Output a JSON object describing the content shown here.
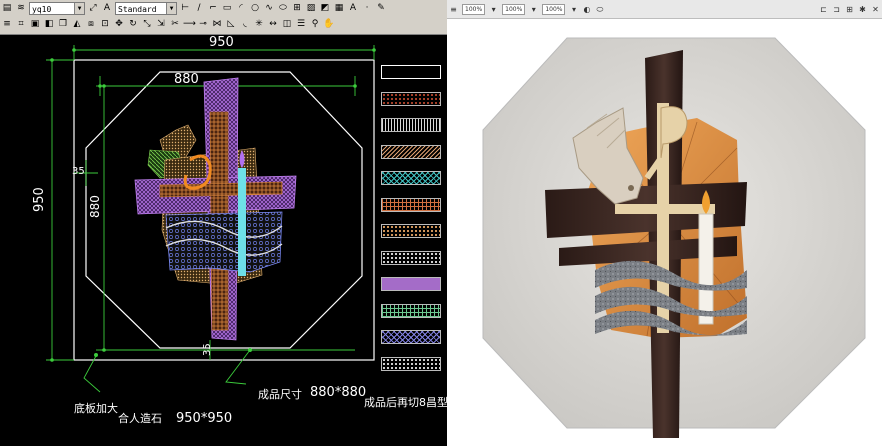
{
  "cad": {
    "toolbar": {
      "layer_value": "yq10",
      "style_value": "Standard"
    },
    "dimensions": {
      "outer_width": "950",
      "inner_width": "880",
      "outer_height": "950",
      "inner_height": "880",
      "corner_offset": "35",
      "bottom_offset": "35"
    },
    "notes": {
      "base_label": "底板加大",
      "base_material": "合人造石",
      "base_size": "950*950",
      "finished_label": "成品尺寸",
      "finished_size": "880*880",
      "cut_note": "成品后再切8昌型"
    },
    "legend_swatches": [
      {
        "pattern": "blank",
        "color": "#ffffff"
      },
      {
        "pattern": "dots",
        "color": "#b0442c"
      },
      {
        "pattern": "vertical-hatch",
        "color": "#d9d9d9"
      },
      {
        "pattern": "lines",
        "color": "#e0a070"
      },
      {
        "pattern": "zigzag",
        "color": "#40c0c0"
      },
      {
        "pattern": "grid",
        "color": "#d07040"
      },
      {
        "pattern": "hex",
        "color": "#e0a060"
      },
      {
        "pattern": "circles",
        "color": "#e0e0e0"
      },
      {
        "pattern": "solid",
        "color": "#a46cc8"
      },
      {
        "pattern": "brick",
        "color": "#6cc890"
      },
      {
        "pattern": "crosshatch",
        "color": "#8080e0"
      },
      {
        "pattern": "speckle",
        "color": "#e0e0e0"
      }
    ]
  },
  "render": {
    "toolbar": {
      "zoom_1": "100%",
      "zoom_2": "100%",
      "zoom_3": "100%"
    },
    "colors": {
      "background": "#dcdad6",
      "cross_dark": "#3a2620",
      "cross_light": "#e6d2a8",
      "sunburst": "#d8883e",
      "water": "#7b7f84",
      "candle": "#f4f1ea",
      "dove": "#d9cfc0"
    }
  }
}
